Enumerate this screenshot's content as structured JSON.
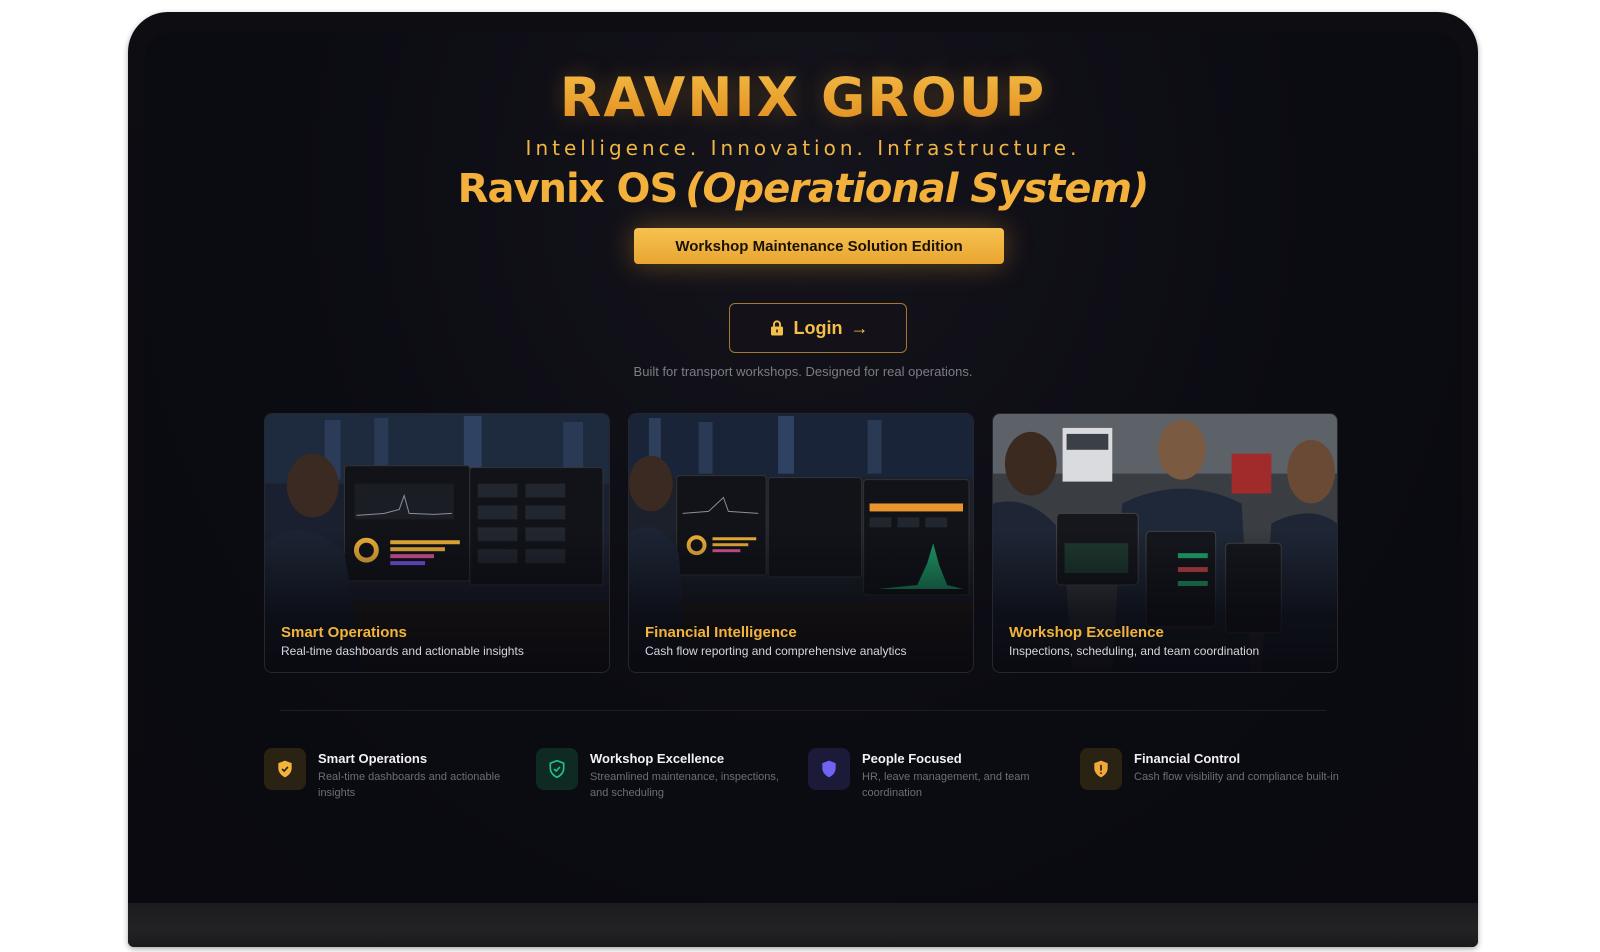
{
  "header": {
    "brand": "RAVNIX GROUP",
    "tagline": "Intelligence. Innovation. Infrastructure.",
    "os_name": "Ravnix OS",
    "os_subtitle": "(Operational System)",
    "edition": "Workshop Maintenance Solution Edition"
  },
  "login": {
    "label": "Login",
    "arrow": "→",
    "icon": "lock-icon"
  },
  "subtext": "Built for transport workshops. Designed for real operations.",
  "cards": [
    {
      "title": "Smart Operations",
      "desc": "Real-time dashboards and actionable insights"
    },
    {
      "title": "Financial Intelligence",
      "desc": "Cash flow reporting and comprehensive analytics"
    },
    {
      "title": "Workshop Excellence",
      "desc": "Inspections, scheduling, and team coordination"
    }
  ],
  "features": [
    {
      "title": "Smart Operations",
      "desc": "Real-time dashboards and actionable insights",
      "icon": "shield-check-icon",
      "color": "#f2b43a"
    },
    {
      "title": "Workshop Excellence",
      "desc": "Streamlined maintenance, inspections, and scheduling",
      "icon": "shield-check-outline-icon",
      "color": "#22c08a"
    },
    {
      "title": "People Focused",
      "desc": "HR, leave management, and team coordination",
      "icon": "shield-icon",
      "color": "#6f63f0"
    },
    {
      "title": "Financial Control",
      "desc": "Cash flow visibility and compliance built-in",
      "icon": "shield-alert-icon",
      "color": "#f2a93a"
    }
  ],
  "colors": {
    "accent": "#f2b43a",
    "background": "#0b0b12"
  }
}
